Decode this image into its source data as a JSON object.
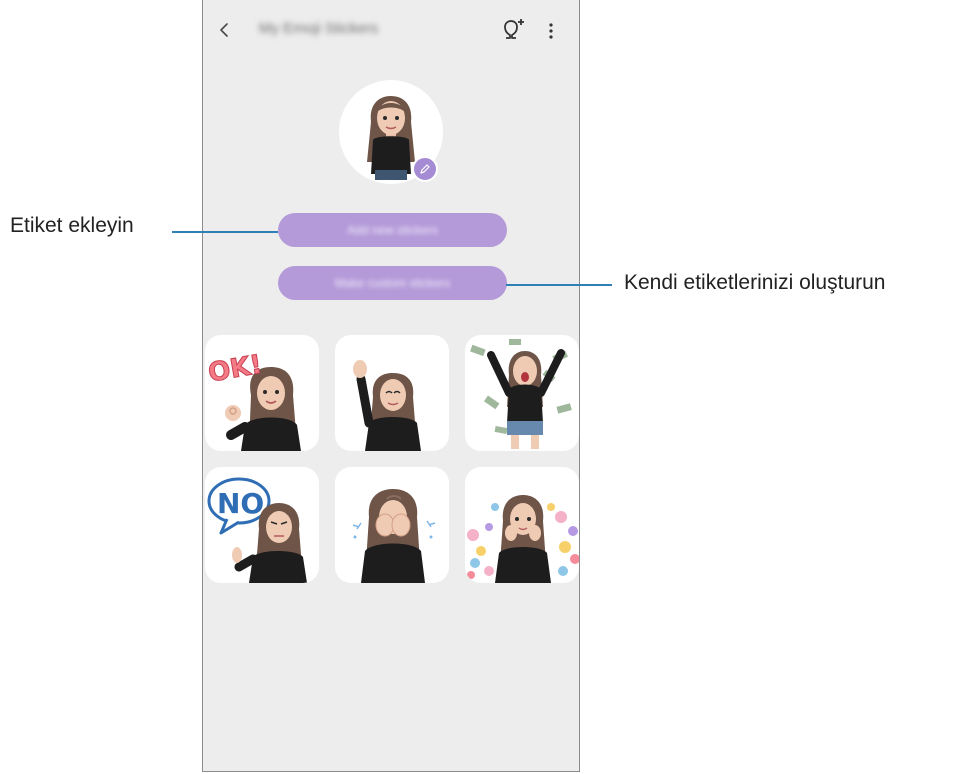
{
  "header": {
    "title": "My Emoji Stickers",
    "back_icon": "chevron-left-icon",
    "add_icon": "add-emoji-icon",
    "more_icon": "more-vertical-icon"
  },
  "profile": {
    "avatar_icon": "avatar-emoji",
    "edit_icon": "pencil-icon"
  },
  "buttons": {
    "add_stickers": "Add new stickers",
    "make_custom": "Make custom stickers"
  },
  "stickers": [
    {
      "name": "ok-sticker",
      "text": "OK!"
    },
    {
      "name": "wave-sticker",
      "text": ""
    },
    {
      "name": "money-rain-sticker",
      "text": ""
    },
    {
      "name": "no-sticker",
      "text": "NO"
    },
    {
      "name": "cry-sticker",
      "text": ""
    },
    {
      "name": "hearts-sticker",
      "text": ""
    }
  ],
  "callouts": {
    "left": "Etiket ekleyin",
    "right": "Kendi etiketlerinizi oluşturun"
  },
  "colors": {
    "accent": "#b49ad9",
    "callout_line": "#2f7fb6",
    "background": "#ededed"
  }
}
